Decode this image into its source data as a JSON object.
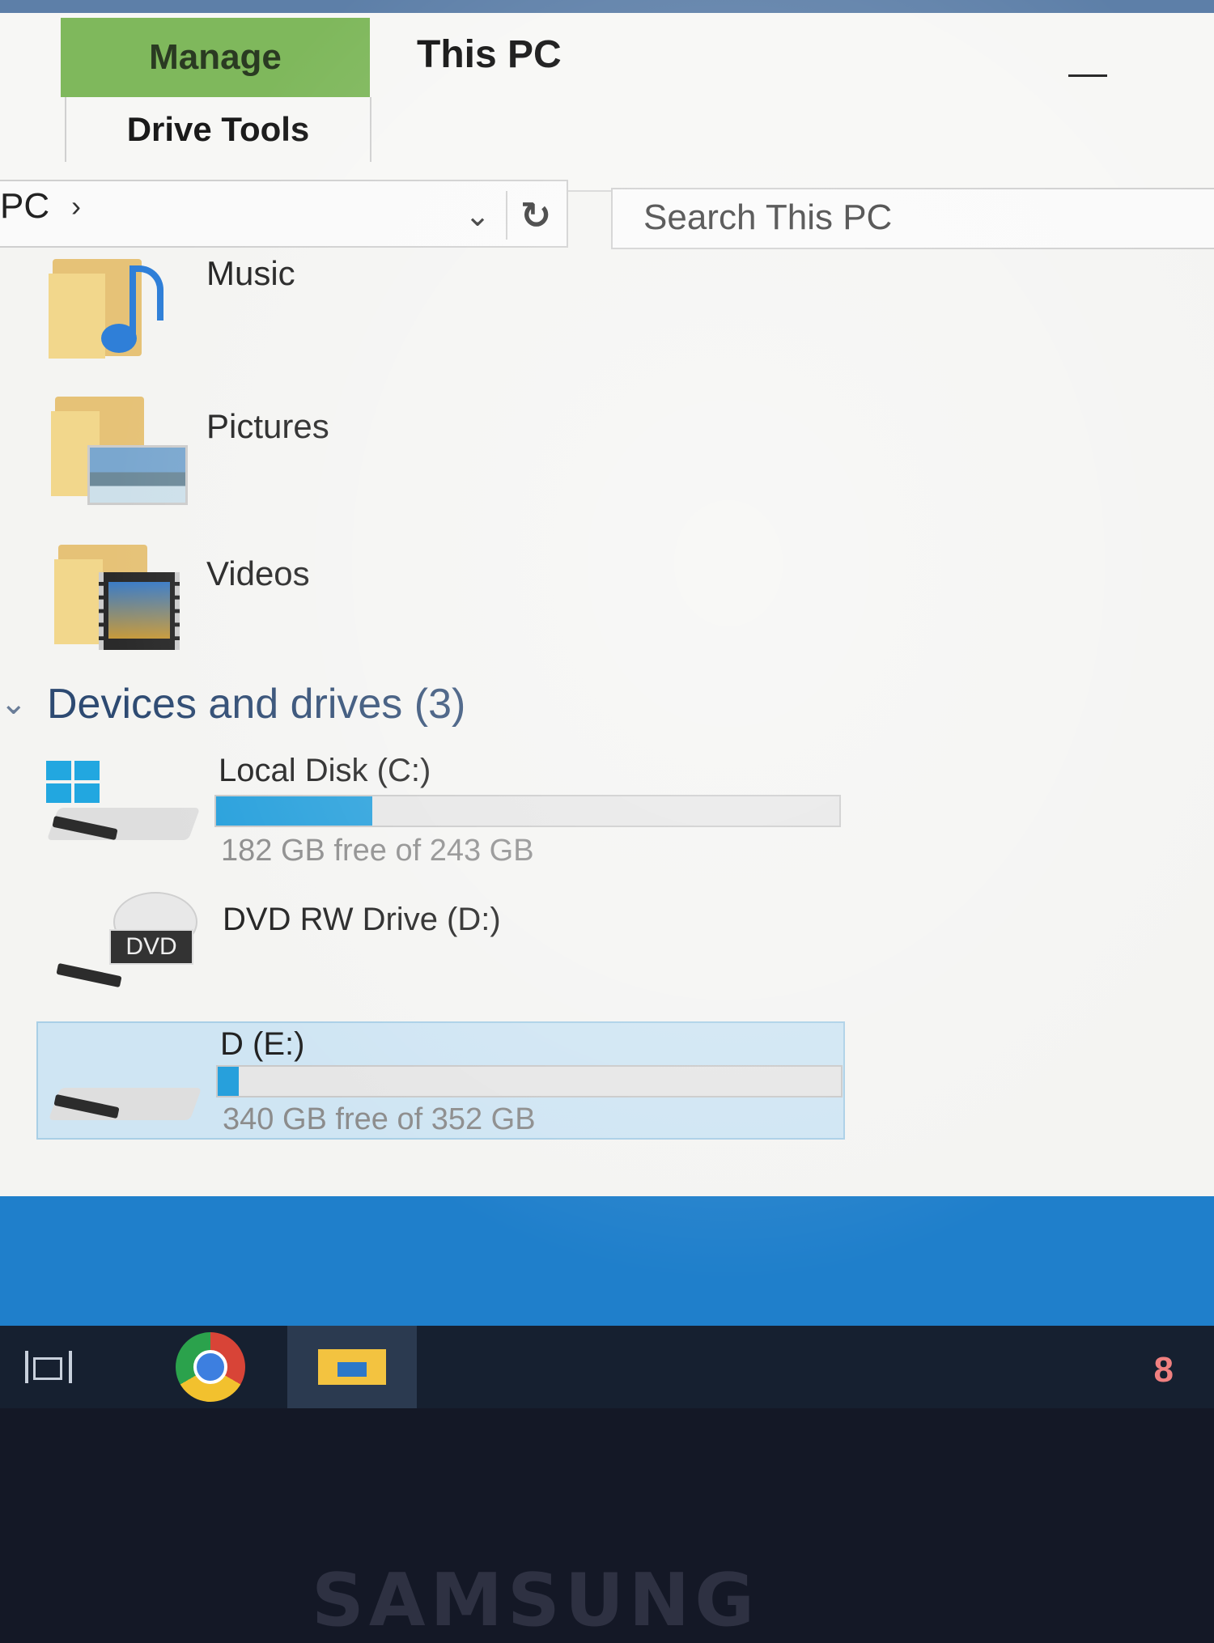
{
  "ribbon": {
    "manage_tab": "Manage",
    "window_title": "This PC",
    "drive_tools": "Drive Tools"
  },
  "address": {
    "crumb": "PC",
    "search_placeholder": "Search This PC"
  },
  "folders": [
    {
      "label": "Music",
      "icon": "music-folder-icon"
    },
    {
      "label": "Pictures",
      "icon": "pictures-folder-icon"
    },
    {
      "label": "Videos",
      "icon": "videos-folder-icon"
    }
  ],
  "devices": {
    "header": "Devices and drives (3)",
    "drives": [
      {
        "name": "Local Disk (C:)",
        "free_text": "182 GB free of 243 GB",
        "used_fraction": 0.251,
        "icon": "windows-drive-icon"
      },
      {
        "name": "DVD RW Drive (D:)",
        "free_text": "",
        "icon": "dvd-drive-icon"
      },
      {
        "name": "D (E:)",
        "free_text": "340 GB free of 352 GB",
        "used_fraction": 0.034,
        "icon": "hard-drive-icon"
      }
    ]
  },
  "taskbar": {
    "tray_text": "8"
  },
  "bezel": {
    "brand": "SAMSUNG"
  },
  "colors": {
    "accent": "#27a0dc",
    "manage_tab": "#7fb85c",
    "taskbar": "#162030",
    "desktop": "#1f7fcb"
  }
}
